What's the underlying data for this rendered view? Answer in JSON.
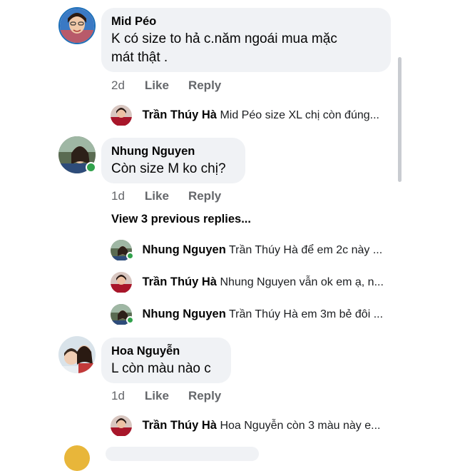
{
  "labels": {
    "like": "Like",
    "reply": "Reply"
  },
  "comments": [
    {
      "author": "Mid Péo",
      "text_line1": "K có size to hả c.năm ngoái mua mặc",
      "text_line2": "mát thật .",
      "time": "2d",
      "replies": [
        {
          "author": "Trần Thúy Hà",
          "text": "Mid Péo size XL chị còn đúng..."
        }
      ]
    },
    {
      "author": "Nhung Nguyen",
      "text_line1": "Còn size M ko chị?",
      "time": "1d",
      "view_more": "View 3 previous replies...",
      "replies": [
        {
          "author": "Nhung Nguyen",
          "text": "Trần Thúy Hà để em 2c này ..."
        },
        {
          "author": "Trần Thúy Hà",
          "text": "Nhung Nguyen vẫn ok em ạ, n..."
        },
        {
          "author": "Nhung Nguyen",
          "text": "Trần Thúy Hà em 3m bẻ đôi ..."
        }
      ]
    },
    {
      "author": "Hoa Nguyễn",
      "text_line1": "L còn màu nào c",
      "time": "1d",
      "replies": [
        {
          "author": "Trần Thúy Hà",
          "text": "Hoa Nguyễn còn 3 màu này e..."
        }
      ]
    }
  ]
}
